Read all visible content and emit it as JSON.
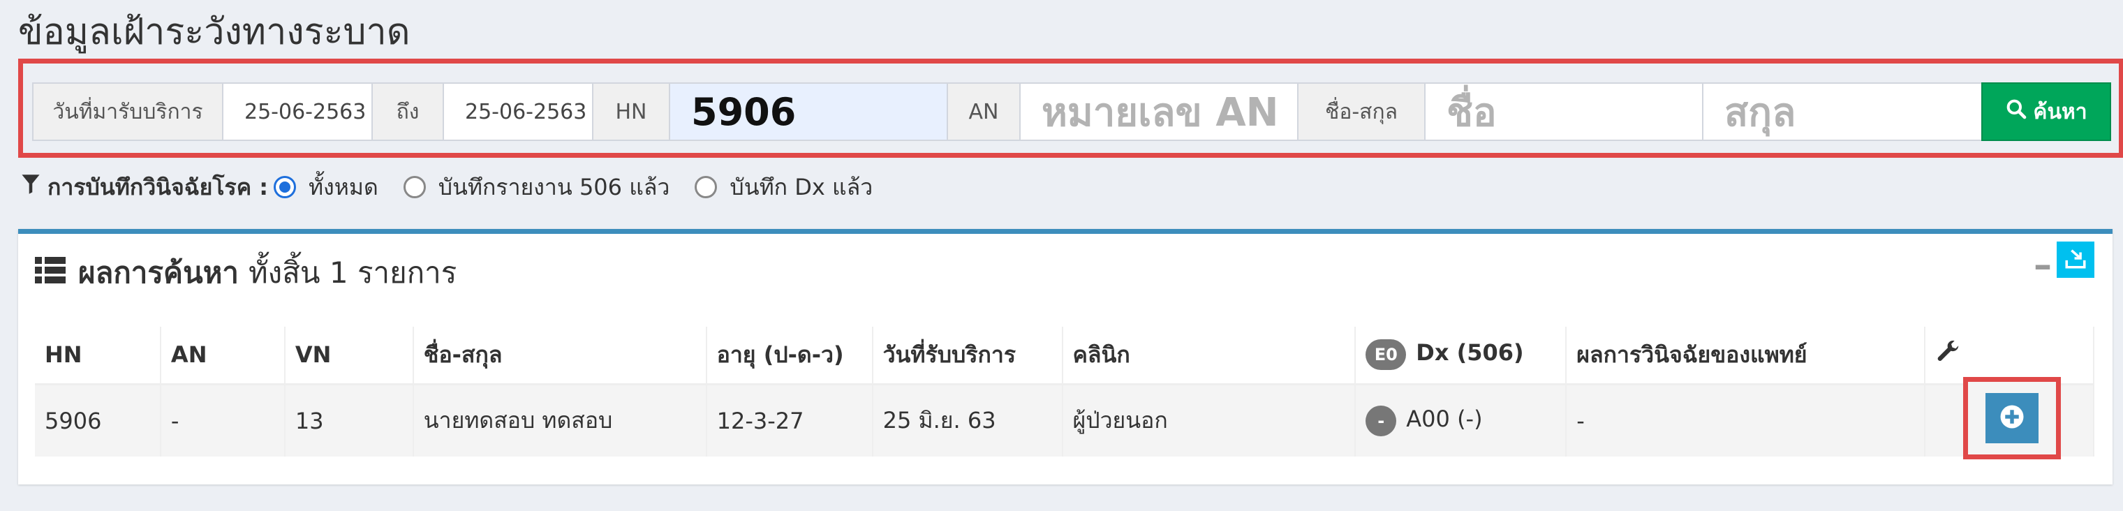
{
  "page": {
    "title": "ข้อมูลเฝ้าระวังทางระบาด"
  },
  "search": {
    "date_label": "วันที่มารับบริการ",
    "date_from": "25-06-2563",
    "to_label": "ถึง",
    "date_to": "25-06-2563",
    "hn_label": "HN",
    "hn_value": "5906",
    "an_label": "AN",
    "an_placeholder": "หมายเลข AN",
    "name_label": "ชื่อ-สกุล",
    "first_name_placeholder": "ชื่อ",
    "last_name_placeholder": "สกุล",
    "search_button": "ค้นหา",
    "search_icon": "search-icon"
  },
  "filter": {
    "label": "การบันทึกวินิจฉัยโรค :",
    "icon": "filter-icon",
    "options": [
      {
        "label": "ทั้งหมด",
        "selected": true
      },
      {
        "label": "บันทึกรายงาน 506 แล้ว",
        "selected": false
      },
      {
        "label": "บันทึก Dx แล้ว",
        "selected": false
      }
    ]
  },
  "results": {
    "title": "ผลการค้นหา",
    "count_text": "ทั้งสิ้น 1 รายการ",
    "collapse": "–",
    "columns": {
      "hn": "HN",
      "an": "AN",
      "vn": "VN",
      "name": "ชื่อ-สกุล",
      "age": "อายุ (ป-ด-ว)",
      "date": "วันที่รับบริการ",
      "clinic": "คลินิก",
      "dx_badge": "E0",
      "dx": "Dx (506)",
      "doctor_dx": "ผลการวินิจฉัยของแพทย์"
    },
    "rows": [
      {
        "hn": "5906",
        "an": "-",
        "vn": "13",
        "name": "นายทดสอบ ทดสอบ",
        "age": "12-3-27",
        "date": "25 มิ.ย. 63",
        "clinic": "ผู้ป่วยนอก",
        "dx_badge": "-",
        "dx": "A00 (-)",
        "doctor_dx": "-"
      }
    ]
  },
  "colors": {
    "search_button": "#00a65a",
    "box_accent": "#3c8dbc",
    "export_button": "#00c0ef",
    "highlight": "#e04848"
  }
}
